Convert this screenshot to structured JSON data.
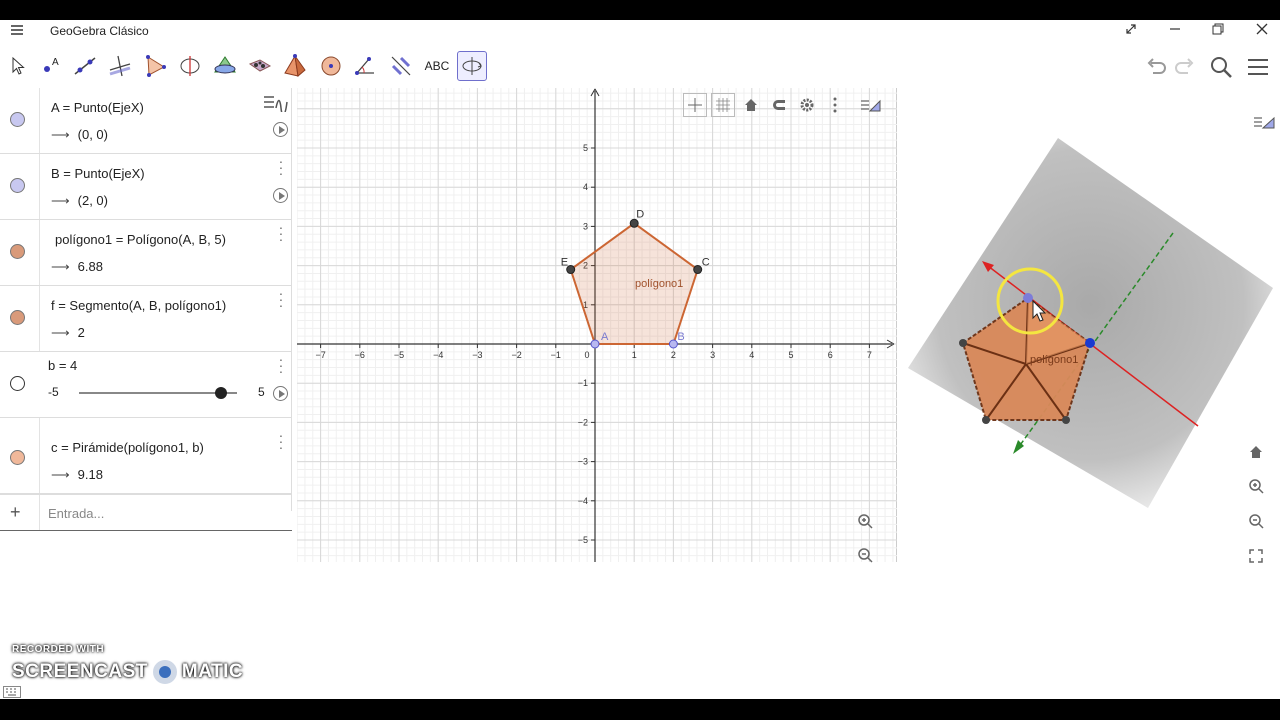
{
  "titlebar": {
    "title": "GeoGebra Clásico",
    "buttons": [
      "resize-icon",
      "minimize-icon",
      "restore-icon",
      "close-icon"
    ]
  },
  "toolbar": {
    "tools": [
      "move-tool",
      "point-tool",
      "line-tool",
      "perpendicular-line-tool",
      "polygon-tool",
      "circle-axis-tool",
      "intersect-surfaces-tool",
      "plane-tool",
      "pyramid-tool",
      "sphere-tool",
      "angle-tool",
      "reflect-tool",
      "text-tool",
      "rotate-view-tool"
    ],
    "text_tool_label": "ABC",
    "right": [
      "undo-icon",
      "redo-icon",
      "search-icon",
      "menu-icon"
    ]
  },
  "algebra": {
    "rows": [
      {
        "definition": "A = Punto(EjeX)",
        "value": "(0, 0)",
        "color": "#c8c8f0"
      },
      {
        "definition": "B = Punto(EjeX)",
        "value": "(2, 0)",
        "color": "#c8c8f0"
      },
      {
        "definition": "polígono1 = Polígono(A, B, 5)",
        "value": "6.88",
        "color": "#d99a7a"
      },
      {
        "definition": "f = Segmento(A, B, polígono1)",
        "value": "2",
        "color": "#d99a7a"
      },
      {
        "definition": "b = 4",
        "slider": {
          "min": "-5",
          "max": "5",
          "value": 4
        }
      },
      {
        "definition": "c = Pirámide(polígono1, b)",
        "value": "9.18",
        "color": "#f0b89a"
      }
    ],
    "input_placeholder": "Entrada..."
  },
  "graphics": {
    "x_ticks": [
      "−7",
      "−6",
      "−5",
      "−4",
      "−3",
      "−2",
      "−1",
      "0",
      "1",
      "2",
      "3",
      "4",
      "5",
      "6",
      "7"
    ],
    "y_ticks": [
      "5",
      "4",
      "3",
      "2",
      "1",
      "−1",
      "−2",
      "−3",
      "−4",
      "−5"
    ],
    "points": [
      {
        "name": "A",
        "x": 0,
        "y": 0
      },
      {
        "name": "B",
        "x": 2,
        "y": 0
      },
      {
        "name": "C",
        "x": 2.62,
        "y": 1.9
      },
      {
        "name": "D",
        "x": 1,
        "y": 3.08
      },
      {
        "name": "E",
        "x": -0.62,
        "y": 1.9
      }
    ],
    "polygon_label": "polígono1",
    "polygon_color": "#cc6633"
  },
  "view3d": {
    "polygon_label": "polígono1"
  },
  "watermark": {
    "line1": "RECORDED WITH",
    "line2a": "SCREENCAST",
    "line2b": "MATIC"
  }
}
